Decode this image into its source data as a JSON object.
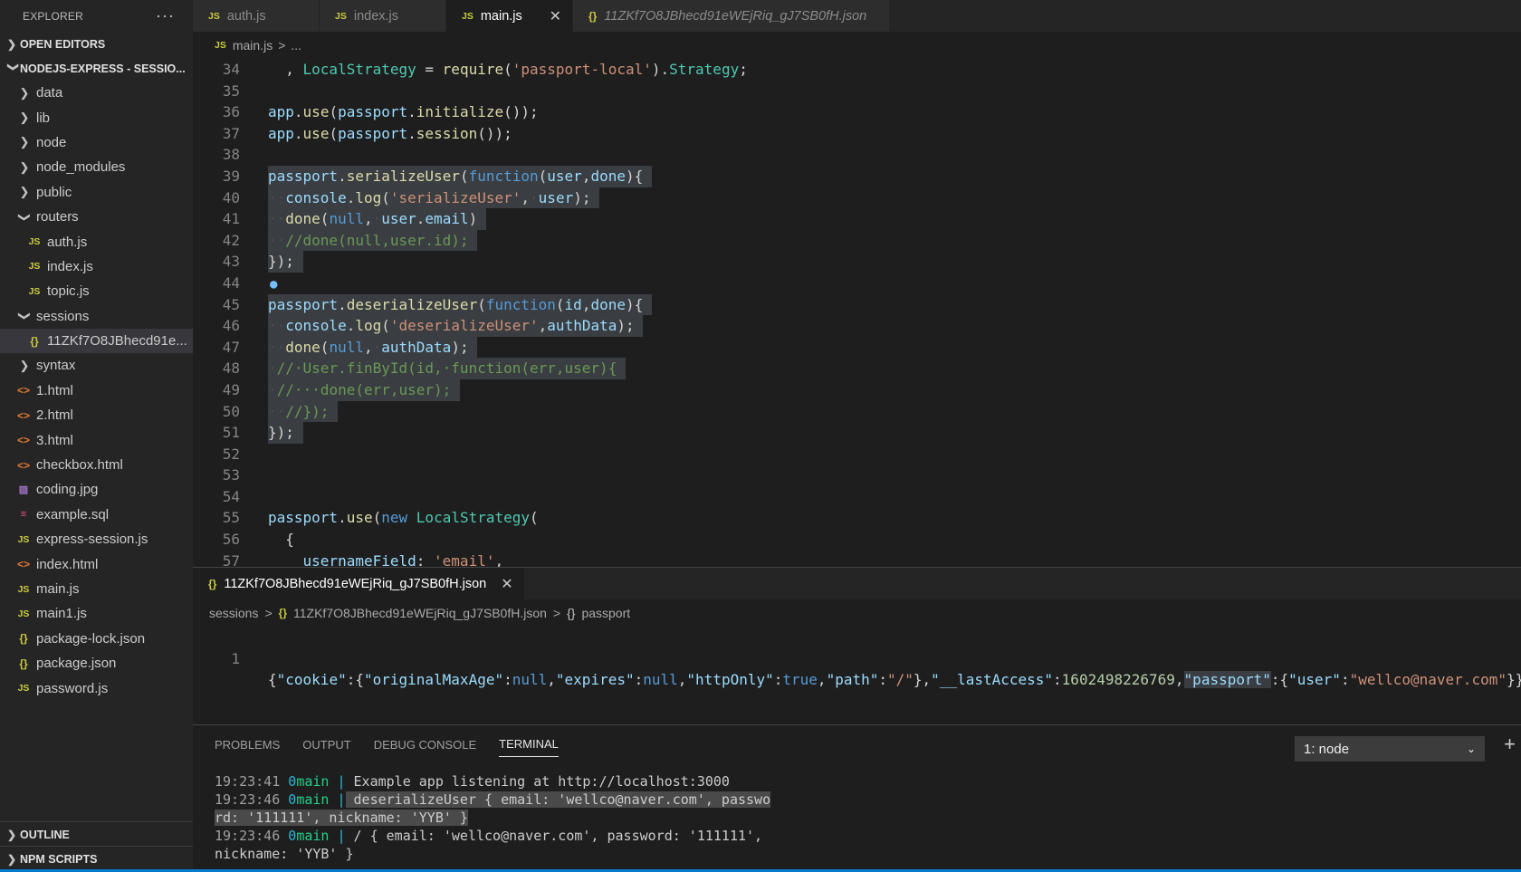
{
  "explorer": {
    "title": "EXPLORER",
    "more": "···",
    "open_editors": "OPEN EDITORS",
    "project": "NODEJS-EXPRESS - SESSIO...",
    "items": [
      {
        "label": "data",
        "kind": "folder",
        "expanded": false,
        "icon": "chevron-right-icon"
      },
      {
        "label": "lib",
        "kind": "folder",
        "expanded": false,
        "icon": "chevron-right-icon"
      },
      {
        "label": "node",
        "kind": "folder",
        "expanded": false,
        "icon": "chevron-right-icon"
      },
      {
        "label": "node_modules",
        "kind": "folder",
        "expanded": false,
        "icon": "chevron-right-icon"
      },
      {
        "label": "public",
        "kind": "folder",
        "expanded": false,
        "icon": "chevron-right-icon"
      },
      {
        "label": "routers",
        "kind": "folder",
        "expanded": true,
        "icon": "chevron-down-icon"
      },
      {
        "label": "auth.js",
        "kind": "js",
        "indent": 2
      },
      {
        "label": "index.js",
        "kind": "js",
        "indent": 2
      },
      {
        "label": "topic.js",
        "kind": "js",
        "indent": 2
      },
      {
        "label": "sessions",
        "kind": "folder",
        "expanded": true,
        "icon": "chevron-down-icon"
      },
      {
        "label": "11ZKf7O8JBhecd91e...",
        "kind": "json",
        "indent": 2,
        "selected": true
      },
      {
        "label": "syntax",
        "kind": "folder",
        "expanded": false,
        "icon": "chevron-right-icon"
      },
      {
        "label": "1.html",
        "kind": "html"
      },
      {
        "label": "2.html",
        "kind": "html"
      },
      {
        "label": "3.html",
        "kind": "html"
      },
      {
        "label": "checkbox.html",
        "kind": "html"
      },
      {
        "label": "coding.jpg",
        "kind": "img"
      },
      {
        "label": "example.sql",
        "kind": "sql"
      },
      {
        "label": "express-session.js",
        "kind": "js"
      },
      {
        "label": "index.html",
        "kind": "html"
      },
      {
        "label": "main.js",
        "kind": "js"
      },
      {
        "label": "main1.js",
        "kind": "js"
      },
      {
        "label": "package-lock.json",
        "kind": "json"
      },
      {
        "label": "package.json",
        "kind": "json"
      },
      {
        "label": "password.js",
        "kind": "js"
      }
    ],
    "outline": "OUTLINE",
    "npm_scripts": "NPM SCRIPTS"
  },
  "icons": {
    "js": "JS",
    "json": "{}",
    "html": "<>",
    "sql": "≡",
    "img": "▨"
  },
  "tabs": [
    {
      "label": "auth.js",
      "kind": "js",
      "active": false
    },
    {
      "label": "index.js",
      "kind": "js",
      "active": false
    },
    {
      "label": "main.js",
      "kind": "js",
      "active": true,
      "close": "✕"
    },
    {
      "label": "11ZKf7O8JBhecd91eWEjRiq_gJ7SB0fH.json",
      "kind": "json",
      "active": false,
      "preview": true
    }
  ],
  "breadcrumb1": {
    "file": "main.js",
    "sep": ">",
    "rest": "..."
  },
  "code_lines": [
    {
      "n": "34",
      "sel": false,
      "html": "  <span class='p'>, </span><span class='ty'>LocalStrategy</span><span class='p'> = </span><span class='fn'>require</span><span class='p'>(</span><span class='s'>'passport-local'</span><span class='p'>).</span><span class='ty'>Strategy</span><span class='p'>;</span>"
    },
    {
      "n": "35",
      "sel": false,
      "html": ""
    },
    {
      "n": "36",
      "sel": false,
      "html": "<span class='v'>app</span><span class='p'>.</span><span class='fn'>use</span><span class='p'>(</span><span class='v'>passport</span><span class='p'>.</span><span class='fn'>initialize</span><span class='p'>());</span>"
    },
    {
      "n": "37",
      "sel": false,
      "html": "<span class='v'>app</span><span class='p'>.</span><span class='fn'>use</span><span class='p'>(</span><span class='v'>passport</span><span class='p'>.</span><span class='fn'>session</span><span class='p'>());</span>"
    },
    {
      "n": "38",
      "sel": false,
      "html": ""
    },
    {
      "n": "39",
      "sel": true,
      "html": "<span class='v'>passport</span><span class='p'>.</span><span class='fn'>serializeUser</span><span class='p'>(</span><span class='k'>function</span><span class='p'>(</span><span class='v'>user</span><span class='p'>,</span><span class='v'>done</span><span class='p'>){ </span>"
    },
    {
      "n": "40",
      "sel": true,
      "html": "<span class='ws'>··</span><span class='v'>console</span><span class='p'>.</span><span class='fn'>log</span><span class='p'>(</span><span class='s'>'serializeUser'</span><span class='p'>,</span><span class='ws'>·</span><span class='v'>user</span><span class='p'>); </span>"
    },
    {
      "n": "41",
      "sel": true,
      "html": "<span class='ws'>··</span><span class='fn'>done</span><span class='p'>(</span><span class='k'>null</span><span class='p'>,</span><span class='ws'>·</span><span class='v'>user</span><span class='p'>.</span><span class='v'>email</span><span class='p'>) </span>"
    },
    {
      "n": "42",
      "sel": true,
      "html": "<span class='ws'>··</span><span class='cm'>//done(null,user.id); </span>"
    },
    {
      "n": "43",
      "sel": true,
      "html": "<span class='p'>}); </span>"
    },
    {
      "n": "44",
      "sel": false,
      "html": "",
      "bulb": true
    },
    {
      "n": "45",
      "sel": true,
      "html": "<span class='v'>passport</span><span class='p'>.</span><span class='fn'>deserializeUser</span><span class='p'>(</span><span class='k'>function</span><span class='p'>(</span><span class='v'>id</span><span class='p'>,</span><span class='v'>done</span><span class='p'>){ </span>"
    },
    {
      "n": "46",
      "sel": true,
      "html": "<span class='ws'>··</span><span class='v'>console</span><span class='p'>.</span><span class='fn'>log</span><span class='p'>(</span><span class='s'>'deserializeUser'</span><span class='p'>,</span><span class='v'>authData</span><span class='p'>); </span>"
    },
    {
      "n": "47",
      "sel": true,
      "html": "<span class='ws'>··</span><span class='fn'>done</span><span class='p'>(</span><span class='k'>null</span><span class='p'>,</span><span class='ws'>·</span><span class='v'>authData</span><span class='p'>); </span>"
    },
    {
      "n": "48",
      "sel": true,
      "html": "<span class='ws'>·</span><span class='cm'>//·User.finById(id,·function(err,user){ </span>"
    },
    {
      "n": "49",
      "sel": true,
      "html": "<span class='ws'>·</span><span class='cm'>//···done(err,user); </span>"
    },
    {
      "n": "50",
      "sel": true,
      "html": "<span class='ws'>··</span><span class='cm'>//}); </span>"
    },
    {
      "n": "51",
      "sel": true,
      "html": "<span class='p'>}); </span>"
    },
    {
      "n": "52",
      "sel": false,
      "html": ""
    },
    {
      "n": "53",
      "sel": false,
      "html": ""
    },
    {
      "n": "54",
      "sel": false,
      "html": ""
    },
    {
      "n": "55",
      "sel": false,
      "html": "<span class='v'>passport</span><span class='p'>.</span><span class='fn'>use</span><span class='p'>(</span><span class='k'>new</span><span class='p'> </span><span class='ty'>LocalStrategy</span><span class='p'>(</span>"
    },
    {
      "n": "56",
      "sel": false,
      "html": "  <span class='p'>{</span>"
    },
    {
      "n": "57",
      "sel": false,
      "html": "    <span class='v'>usernameField</span><span class='p'>: </span><span class='s'>'email'</span><span class='p'>,</span>"
    }
  ],
  "json_tab": {
    "label": "11ZKf7O8JBhecd91eWEjRiq_gJ7SB0fH.json",
    "close": "✕"
  },
  "breadcrumb2": {
    "folder": "sessions",
    "file": "11ZKf7O8JBhecd91eWEjRiq_gJ7SB0fH.json",
    "symbol": "passport",
    "sep": ">"
  },
  "json_line": {
    "n": "1",
    "html": "<span class='p'>{</span><span class='v'>\"cookie\"</span><span class='p'>:{</span><span class='v'>\"originalMaxAge\"</span><span class='p'>:</span><span class='k'>null</span><span class='p'>,</span><span class='v'>\"expires\"</span><span class='p'>:</span><span class='k'>null</span><span class='p'>,</span><span class='v'>\"httpOnly\"</span><span class='p'>:</span><span class='k'>true</span><span class='p'>,</span><span class='v'>\"path\"</span><span class='p'>:</span><span class='s'>\"/\"</span><span class='p'>},</span><span class='v'>\"__lastAccess\"</span><span class='p'>:</span><span class='n'>1602498226769</span><span class='p'>,</span><span class='v sel'>\"passport\"</span><span class='p'>:{</span><span class='v'>\"user\"</span><span class='p'>:</span><span class='s'>\"wellco@naver.com\"</span><span class='p'>}}</span>"
  },
  "panel": {
    "tabs": [
      {
        "label": "PROBLEMS",
        "active": false
      },
      {
        "label": "OUTPUT",
        "active": false
      },
      {
        "label": "DEBUG CONSOLE",
        "active": false
      },
      {
        "label": "TERMINAL",
        "active": true
      }
    ],
    "terminal_select": "1: node",
    "add": "+",
    "lines": [
      {
        "ts": "19:23:41",
        "id": "0",
        "proc": "main",
        "bar": " |",
        "text": " Example app listening at http://localhost:3000",
        "sel": false
      },
      {
        "ts": "19:23:46",
        "id": "0",
        "proc": "main",
        "bar": " |",
        "text": " deserializeUser { email: 'wellco@naver.com', passwo",
        "sel": true
      },
      {
        "ts": "",
        "id": "",
        "proc": "",
        "bar": "",
        "text": "rd: '111111', nickname: 'YYB' }",
        "sel": true,
        "cont": true
      },
      {
        "ts": "19:23:46",
        "id": "0",
        "proc": "main",
        "bar": " |",
        "text": " / { email: 'wellco@naver.com', password: '111111',",
        "sel": false
      },
      {
        "ts": "",
        "id": "",
        "proc": "",
        "bar": "",
        "text": "nickname: 'YYB' }",
        "sel": false,
        "cont": true
      }
    ]
  },
  "colors": {
    "accent": "#007acc",
    "sidebar": "#252526",
    "editor": "#1e1e1e",
    "selection": "#3a3d41"
  }
}
